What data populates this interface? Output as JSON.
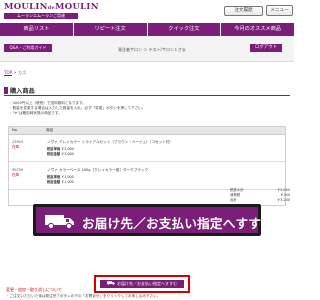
{
  "header": {
    "logo_main": "MOULIN",
    "logo_small": "de",
    "logo_main2": "MOULIN",
    "logo_sub": "ムーランエムーランご用達",
    "cart_label": "注文履歴",
    "menu_label": "メニュー"
  },
  "nav": {
    "items": [
      "商品リスト",
      "リピート注文",
      "クイック注文",
      "今月のオススメ商品"
    ]
  },
  "subbar": {
    "qa_label": "Q&A・ご利用ガイド",
    "salon_text": "発注者サロン ＞ テスト/サロン１さま",
    "logout_label": "ログアウト"
  },
  "breadcrumb": {
    "top": "TOP",
    "separator": " > ",
    "current": "カゴ"
  },
  "page": {
    "title": "購入商品"
  },
  "notes": [
    "・4000円以上（税別）で送料無料となります。",
    "・数量を変更する場合は入力した数量を入れ、必ず「変更」ボタンを押して下さい。",
    "・\"※\"は梱包時状態の商品です。"
  ],
  "table": {
    "header_no": "No",
    "header_name": "商品",
    "rows": [
      {
        "code": "23904",
        "stock": "在庫",
        "name": "ノヴァ アレイカラー トライアルセット（ブラウン・ベージュ）（コセット付）",
        "label1": "税抜単価",
        "value1": "￥2,000",
        "label2": "税抜金額",
        "value2": "￥2,000"
      },
      {
        "code": "99799",
        "stock": "在庫",
        "name": "ノヴァ カラーベース 200g［クレイカラー用］ダークブラック",
        "label1": "税抜単価",
        "value1": "￥1,000",
        "label2": "税抜金額",
        "value2": "￥1,000"
      }
    ]
  },
  "totals": {
    "rows": [
      {
        "label": "税抜小計",
        "value": "￥3,000"
      },
      {
        "label": "消費税",
        "value": "￥240"
      },
      {
        "label": "合計",
        "value": "￥3,240"
      }
    ]
  },
  "callout": {
    "label": "お届け先／お支払い指定へすすむ"
  },
  "small_button": {
    "label": "お届け先／お支払い指定へすすむ"
  },
  "warning": {
    "title": "変更・追加・取り消しについて",
    "text": "・ご注文いただいた後は発注完了ボタンの下の「お問合せ」をクリックしてお申し込み下さい。"
  },
  "colors": {
    "brand": "#7a1e78",
    "alert": "#d40000"
  }
}
